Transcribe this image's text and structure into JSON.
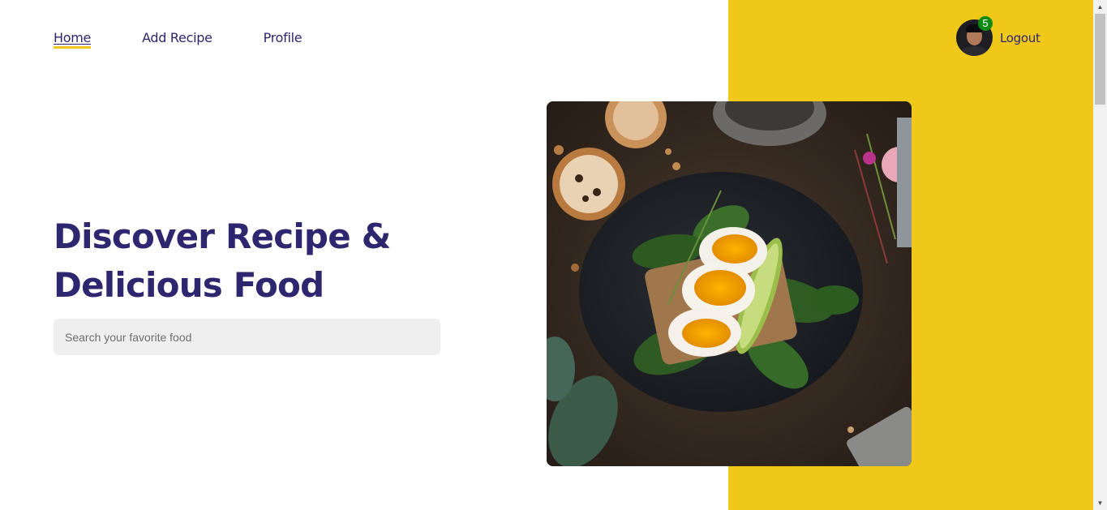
{
  "nav": {
    "home": "Home",
    "add_recipe": "Add Recipe",
    "profile": "Profile"
  },
  "user": {
    "notification_count": "5",
    "logout": "Logout"
  },
  "hero": {
    "title_line1": "Discover Recipe &",
    "title_line2": "Delicious Food",
    "search_placeholder": "Search your favorite food"
  },
  "colors": {
    "accent_yellow": "#efc81a",
    "text_navy": "#2e266f",
    "badge_green": "#0e8a10"
  }
}
